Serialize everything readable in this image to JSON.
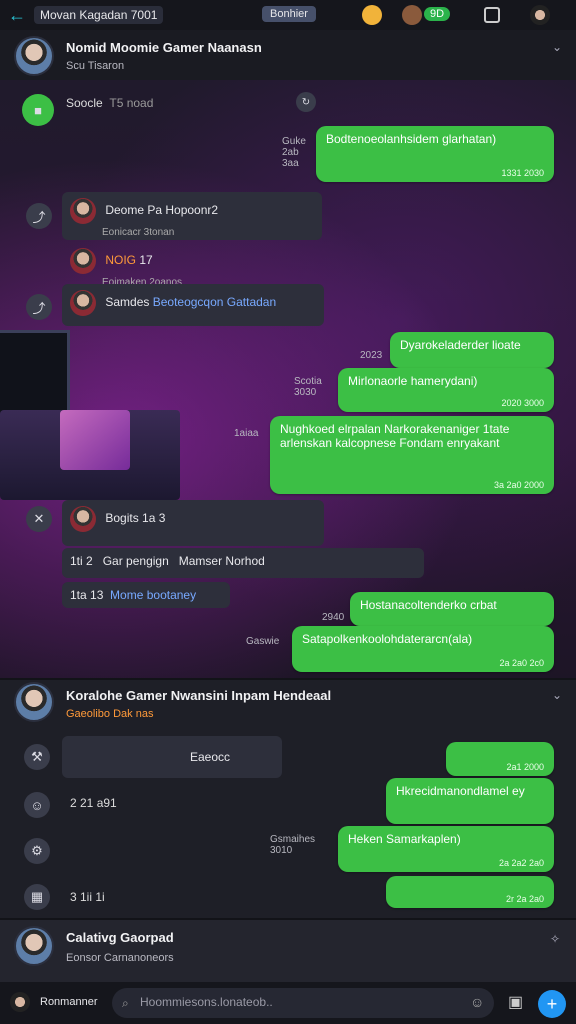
{
  "topbar": {
    "back_icon": "arrow-left-icon",
    "title": "Movan Kagadan 7001",
    "pill": "Bonhier",
    "online_badge": "9D"
  },
  "section1": {
    "header": {
      "name": "Nomid Moomie Gamer Naanasn",
      "sub": "Scu  Tisaron",
      "verified_icon": "check-icon"
    },
    "pinned": {
      "label": "Soocle",
      "count": "T5 noad"
    },
    "messages": [
      {
        "text": "Bodtenoeolanhsidem glarhatan)",
        "time": "1331 2030",
        "side_time": "Guke 2ab 3aa"
      },
      {
        "name": "Deome Pa Hopoonr2",
        "sub": "Eonicacr 3tonan"
      },
      {
        "name": "NOIG",
        "sub": "Eoimaken  2oanos",
        "count": "17"
      },
      {
        "name": "Samdes",
        "link": "Beoteogcqon Gattadan"
      },
      {
        "text": "Dyarokeladerder lioate",
        "time": "2023"
      },
      {
        "side": "Scotia  3030",
        "text": "Mirlonaorle hamerydani)",
        "time": "2020 3000"
      },
      {
        "side": "1aiaa",
        "text": "Nughkoed elrpalan Narkorakenaniger 1tate arlenskan kalcopnese Fondam enryakant",
        "time": "3a 2a0 2000"
      },
      {
        "name": "Bogits",
        "sub": "1a 3",
        "icon": "smile-icon"
      },
      {
        "text": "Gar pengign",
        "extra": "Mamser Norhod",
        "side": "1ti 2"
      },
      {
        "link": "Mome bootaney",
        "side": "1ta 13"
      },
      {
        "text": "Hostanacoltenderko crbat",
        "time": "2940"
      },
      {
        "side": "Gaswie",
        "text": "Satapolkenkoolohdaterarcn(ala)",
        "time": "2a 2a0 2c0"
      }
    ]
  },
  "section2": {
    "header": {
      "name": "Koralohe Gamer Nwansini Inpam Hendeaal",
      "sub": "Gaeolibo Dak nas"
    },
    "messages": [
      {
        "text": "Eaeocc",
        "time": "2a1 2000"
      },
      {
        "row": "2  21  a91",
        "time": "2030"
      },
      {
        "text": "Hkrecidmanondlamel ey",
        "time": "1133"
      },
      {
        "side": "Gsmaihes 3010",
        "text": "Heken Samarkaplen)",
        "time": "2a 2a2 2a0"
      },
      {
        "row": "3  1ii  1i",
        "time": "2r 2a 2a0"
      }
    ]
  },
  "section3": {
    "header": {
      "name": "Calativg Gaorpad",
      "sub": "Eonsor Carnanoneors"
    }
  },
  "composer": {
    "label": "Ronmanner",
    "placeholder": "Hoommiesons.lonateob..",
    "send_icon": "plus-icon"
  },
  "colors": {
    "accent": "#29c7d8",
    "bubble_out": "#3cbf45",
    "bubble_in": "#2d2f3b",
    "send": "#2196f3"
  }
}
